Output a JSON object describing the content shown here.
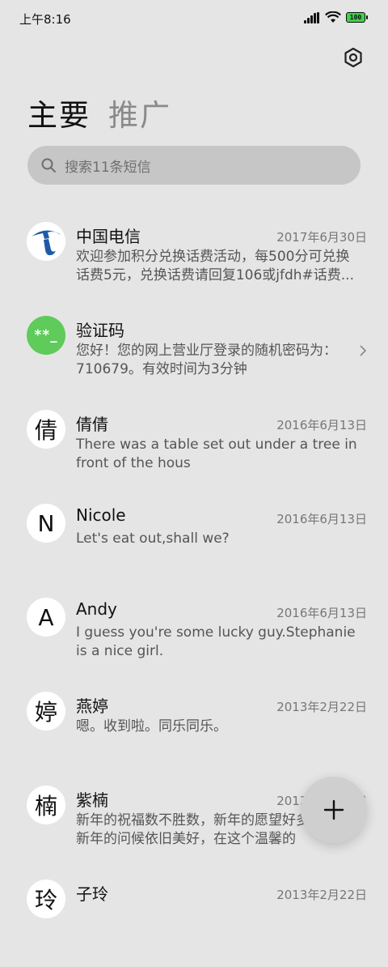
{
  "status_bar": {
    "time": "上午8:16",
    "battery": "100"
  },
  "tabs": [
    {
      "label": "主要"
    },
    {
      "label": "推广"
    }
  ],
  "search": {
    "placeholder": "搜索11条短信"
  },
  "conversations": [
    {
      "name": "中国电信",
      "date": "2017年6月30日",
      "avatar": "telecom-logo",
      "preview": "欢迎参加积分兑换话费活动，每500分可兑换话费5元，兑换话费请回复106或jfdh#话费..."
    },
    {
      "name": "验证码",
      "date": "",
      "avatar": "**_",
      "preview": "您好！您的网上营业厅登录的随机密码为：710679。有效时间为3分钟"
    },
    {
      "name": "倩倩",
      "date": "2016年6月13日",
      "avatar": "倩",
      "preview": "There was a table set out under a tree in front of the hous"
    },
    {
      "name": "Nicole",
      "date": "2016年6月13日",
      "avatar": "N",
      "preview": "Let's eat out,shall we?"
    },
    {
      "name": "Andy",
      "date": "2016年6月13日",
      "avatar": "A",
      "preview": "I guess you're some lucky guy.Stephanie is a nice girl."
    },
    {
      "name": "燕婷",
      "date": "2013年2月22日",
      "avatar": "婷",
      "preview": "嗯。收到啦。同乐同乐。"
    },
    {
      "name": "紫楠",
      "date": "2013年2月22日",
      "avatar": "楠",
      "preview": "新年的祝福数不胜数，新年的愿望好多好多，新年的问候依旧美好，在这个温馨的"
    },
    {
      "name": "子玲",
      "date": "2013年2月22日",
      "avatar": "玲",
      "preview": ""
    }
  ],
  "icons": {
    "settings": "gear-icon",
    "search": "search-icon",
    "compose": "plus-icon",
    "chevron": "chevron-right-icon"
  },
  "colors": {
    "background": "#e5e5e5",
    "verification_avatar": "#5ecb5a",
    "telecom_blue": "#1f5aa8",
    "battery": "#3fd14a"
  }
}
